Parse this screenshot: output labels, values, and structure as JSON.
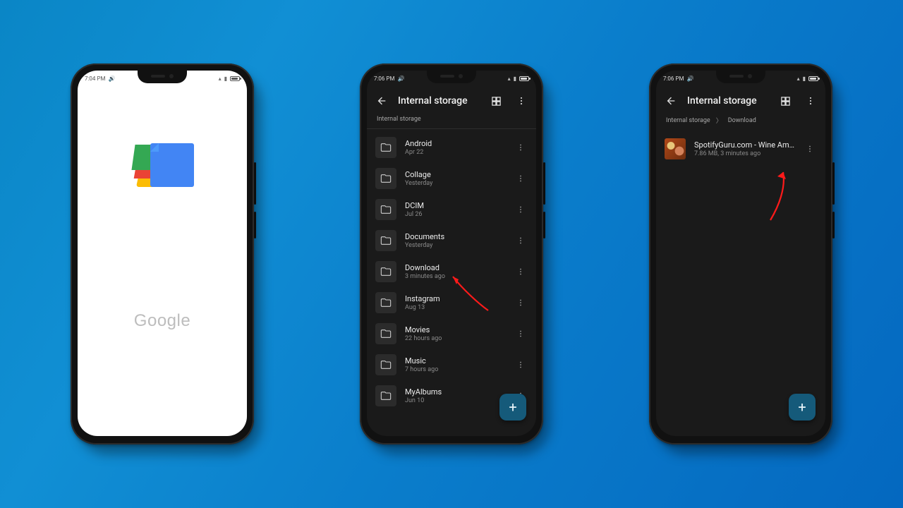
{
  "bg_gradient": [
    "#0a86c6",
    "#0468c0"
  ],
  "phone1": {
    "status_time": "7:04 PM",
    "brand_text": "Google"
  },
  "phone2": {
    "status_time": "7:06 PM",
    "title": "Internal storage",
    "breadcrumb": {
      "root": "Internal storage"
    },
    "fab_label": "+",
    "rows": [
      {
        "name": "Android",
        "sub": "Apr 22"
      },
      {
        "name": "Collage",
        "sub": "Yesterday"
      },
      {
        "name": "DCIM",
        "sub": "Jul 26"
      },
      {
        "name": "Documents",
        "sub": "Yesterday"
      },
      {
        "name": "Download",
        "sub": "3 minutes ago"
      },
      {
        "name": "Instagram",
        "sub": "Aug 13"
      },
      {
        "name": "Movies",
        "sub": "22 hours ago"
      },
      {
        "name": "Music",
        "sub": "7 hours ago"
      },
      {
        "name": "MyAlbums",
        "sub": "Jun 10"
      }
    ]
  },
  "phone3": {
    "status_time": "7:06 PM",
    "title": "Internal storage",
    "breadcrumb": {
      "root": "Internal storage",
      "leaf": "Download"
    },
    "fab_label": "+",
    "files": [
      {
        "name": "SpotifyGuru.com - Wine Am Go L…",
        "sub": "7.86 MB, 3 minutes ago"
      }
    ]
  }
}
